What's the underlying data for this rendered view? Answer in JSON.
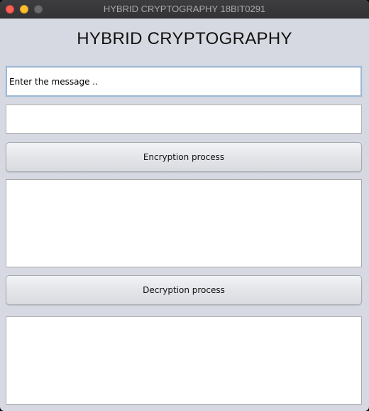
{
  "window": {
    "title": "HYBRID CRYPTOGRAPHY 18BIT0291"
  },
  "heading": "HYBRID CRYPTOGRAPHY",
  "message_input": {
    "value": "Enter the message ..",
    "placeholder": ""
  },
  "key_input": {
    "value": ""
  },
  "encrypt_button": {
    "label": "Encryption process"
  },
  "encrypted_output": {
    "value": ""
  },
  "decrypt_button": {
    "label": "Decryption process"
  },
  "decrypted_output": {
    "value": ""
  },
  "colors": {
    "window_bg": "#d6d9e1",
    "titlebar_bg": "#3d3d3f",
    "close": "#fe5f57",
    "minimize": "#febc2e",
    "zoom": "#6b6b6d",
    "focus_ring": "#9fb9d4"
  }
}
